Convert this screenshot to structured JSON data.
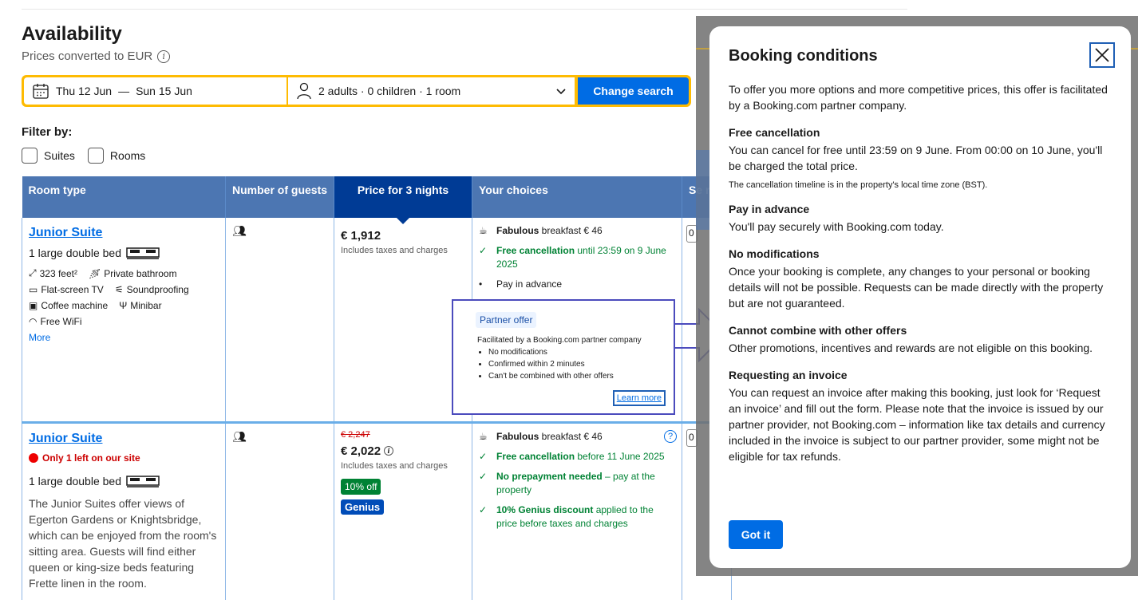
{
  "header": {
    "title": "Availability",
    "subtitle": "Prices converted to EUR"
  },
  "search": {
    "checkin": "Thu 12 Jun",
    "separator": "—",
    "checkout": "Sun 15 Jun",
    "guests": "2 adults · 0 children · 1 room",
    "button": "Change search"
  },
  "filter": {
    "label": "Filter by:",
    "options": [
      "Suites",
      "Rooms"
    ]
  },
  "table": {
    "headers": [
      "Room type",
      "Number of guests",
      "Price for 3 nights",
      "Your choices",
      "Se ro"
    ],
    "rows": [
      {
        "name": "Junior Suite",
        "bed": "1 large double bed",
        "amenities": [
          "323 feet²",
          "Private bathroom",
          "Flat-screen TV",
          "Soundproofing",
          "Coffee machine",
          "Minibar",
          "Free WiFi"
        ],
        "more": "More",
        "price": "€ 1,912",
        "taxes": "Includes taxes and charges",
        "choices": {
          "breakfast_bold": "Fabulous",
          "breakfast_rest": " breakfast € 46",
          "cancel_bold": "Free cancellation",
          "cancel_rest": " until 23:59 on 9 June 2025",
          "pay": "Pay in advance"
        },
        "qty": "0"
      },
      {
        "name": "Junior Suite",
        "scarcity": "Only 1 left on our site",
        "bed": "1 large double bed",
        "description": "The Junior Suites offer views of Egerton Gardens or Knightsbridge, which can be enjoyed from the room's sitting area. Guests will find either queen or king-size beds featuring Frette linen in the room.",
        "old_price": "€ 2,247",
        "price": "€ 2,022",
        "taxes": "Includes taxes and charges",
        "discount_badge": "10% off",
        "genius_badge": "Genius",
        "choices": {
          "breakfast_bold": "Fabulous",
          "breakfast_rest": " breakfast € 46",
          "cancel_bold": "Free cancellation",
          "cancel_rest": " before 11 June 2025",
          "prepay_bold": "No prepayment needed",
          "prepay_rest": " – pay at the property",
          "genius_bold": "10% Genius discount",
          "genius_rest": " applied to the price before taxes and charges"
        },
        "qty": "0"
      }
    ]
  },
  "partner": {
    "tag": "Partner offer",
    "intro": "Facilitated by a Booking.com partner company",
    "bullets": [
      "No modifications",
      "Confirmed within 2 minutes",
      "Can't be combined with other offers"
    ],
    "learn_more": "Learn more"
  },
  "modal": {
    "title": "Booking conditions",
    "intro": "To offer you more options and more competitive prices, this offer is facilitated by a Booking.com partner company.",
    "sections": [
      {
        "heading": "Free cancellation",
        "body": "You can cancel for free until 23:59 on 9 June. From 00:00 on 10 June, you'll be charged the total price.",
        "note": "The cancellation timeline is in the property's local time zone (BST)."
      },
      {
        "heading": "Pay in advance",
        "body": "You'll pay securely with Booking.com today."
      },
      {
        "heading": "No modifications",
        "body": "Once your booking is complete, any changes to your personal or booking details will not be possible. Requests can be made directly with the property but are not guaranteed."
      },
      {
        "heading": "Cannot combine with other offers",
        "body": "Other promotions, incentives and rewards are not eligible on this booking."
      },
      {
        "heading": "Requesting an invoice",
        "body": "You can request an invoice after making this booking, just look for ‘Request an invoice’ and fill out the form. Please note that the invoice is issued by our partner provider, not Booking.com – information like tax details and currency included in the invoice is subject to our partner provider, some might not be eligible for tax refunds."
      }
    ],
    "button": "Got it"
  },
  "colors": {
    "accent": "#006ce4",
    "header_blue": "#4c76b2",
    "dark_blue": "#003b95",
    "search_yellow": "#febb02",
    "green": "#008234"
  }
}
